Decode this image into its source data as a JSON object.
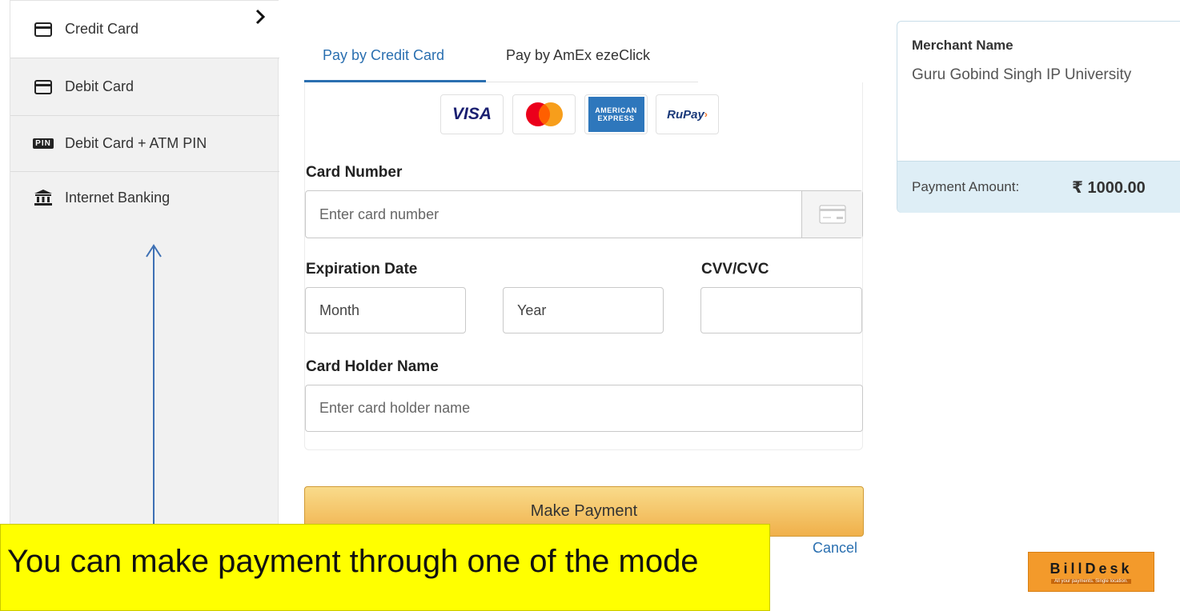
{
  "sidebar": {
    "items": [
      {
        "label": "Credit Card",
        "icon": "credit-card-icon",
        "active": true
      },
      {
        "label": "Debit Card",
        "icon": "debit-card-icon",
        "active": false
      },
      {
        "label": "Debit Card + ATM PIN",
        "icon": "pin-icon",
        "active": false
      },
      {
        "label": "Internet Banking",
        "icon": "bank-icon",
        "active": false
      }
    ],
    "pin_badge": "PIN"
  },
  "tabs": [
    {
      "label": "Pay by Credit Card",
      "active": true
    },
    {
      "label": "Pay by AmEx ezeClick",
      "active": false
    }
  ],
  "card_logos": {
    "visa": "VISA",
    "amex_line1": "AMERICAN",
    "amex_line2": "EXPRESS",
    "rupay": "RuPay"
  },
  "form": {
    "card_number_label": "Card Number",
    "card_number_placeholder": "Enter card number",
    "expiration_label": "Expiration Date",
    "month_placeholder": "Month",
    "year_placeholder": "Year",
    "cvv_label": "CVV/CVC",
    "holder_label": "Card Holder Name",
    "holder_placeholder": "Enter card holder name"
  },
  "actions": {
    "make_payment": "Make Payment",
    "cancel": "Cancel"
  },
  "merchant": {
    "title": "Merchant Name",
    "name": "Guru Gobind Singh IP University",
    "amount_label": "Payment Amount:",
    "amount_value": "₹ 1000.00"
  },
  "billdesk": {
    "name": "BillDesk",
    "tagline": "All your payments. Single location."
  },
  "annotation": {
    "text": "You can make payment through one of the mode"
  },
  "colors": {
    "accent_blue": "#2a6fb0",
    "button_gold": "#f0b04a",
    "annotation_yellow": "#ffff00",
    "billdesk_orange": "#f39a2b"
  }
}
